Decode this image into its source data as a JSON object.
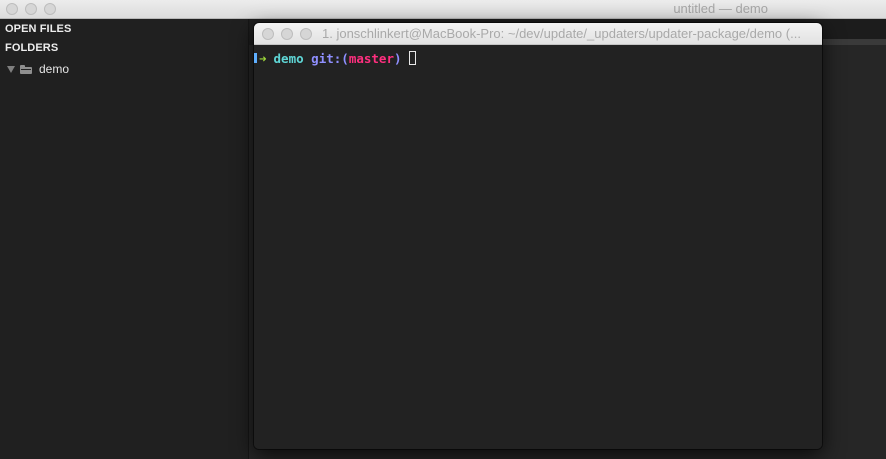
{
  "editor": {
    "title": "untitled — demo",
    "sidebar": {
      "open_files_heading": "OPEN FILES",
      "folders_heading": "FOLDERS",
      "folders": [
        {
          "label": "demo",
          "icon": "folder-icon",
          "expanded": true
        }
      ]
    }
  },
  "terminal": {
    "title": "1. jonschlinkert@MacBook-Pro: ~/dev/update/_updaters/updater-package/demo (...",
    "prompt": {
      "arrow": "➜",
      "dir": "demo",
      "git_label": "git:(",
      "branch": "master",
      "git_close": ")"
    }
  },
  "colors": {
    "prompt_arrow": "#9ed93a",
    "prompt_dir": "#5fd7d7",
    "git_label": "#8f8fff",
    "branch": "#ff2f7f",
    "terminal_bg": "#222222",
    "sidebar_bg": "#202020"
  }
}
